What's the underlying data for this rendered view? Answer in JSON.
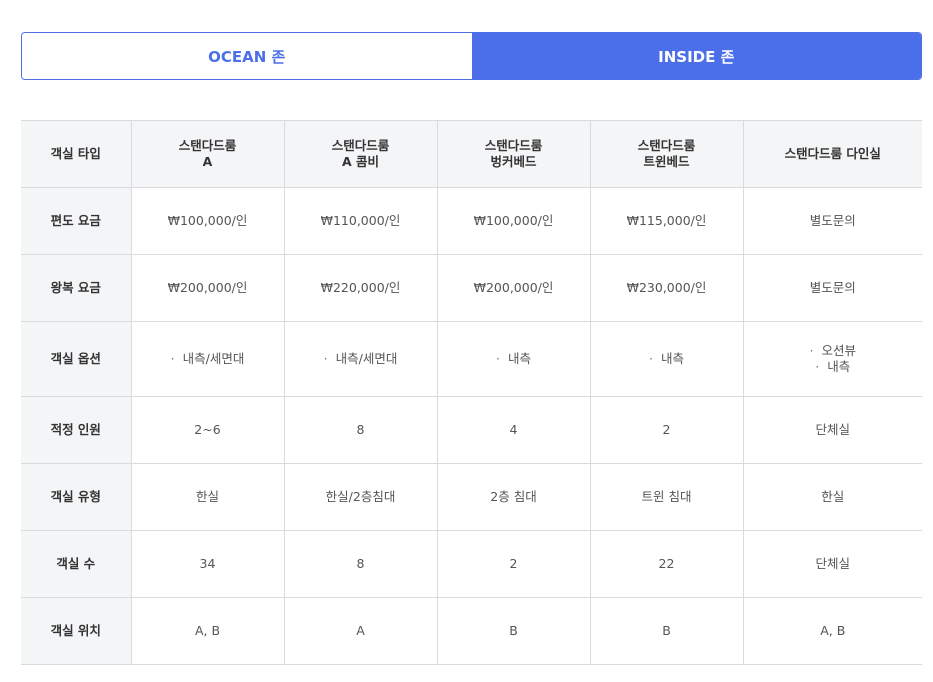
{
  "tabs": [
    {
      "label": "OCEAN 존",
      "active": false
    },
    {
      "label": "INSIDE 존",
      "active": true
    }
  ],
  "colors": {
    "accent": "#4a6fe8",
    "header_bg": "#f4f5f7",
    "border": "#d8dadd"
  },
  "table": {
    "corner_label": "객실 타입",
    "columns": [
      {
        "line1": "스탠다드룸",
        "line2": "A"
      },
      {
        "line1": "스탠다드룸",
        "line2": "A 콤비"
      },
      {
        "line1": "스탠다드룸",
        "line2": "벙커베드"
      },
      {
        "line1": "스탠다드룸",
        "line2": "트윈베드"
      },
      {
        "line1": "스탠다드룸 다인실",
        "line2": ""
      }
    ],
    "rows": {
      "oneway": {
        "label": "편도 요금",
        "cells": [
          "₩100,000/인",
          "₩110,000/인",
          "₩100,000/인",
          "₩115,000/인",
          "별도문의"
        ]
      },
      "roundtrip": {
        "label": "왕복 요금",
        "cells": [
          "₩200,000/인",
          "₩220,000/인",
          "₩200,000/인",
          "₩230,000/인",
          "별도문의"
        ]
      },
      "options": {
        "label": "객실 옵션",
        "cells": [
          [
            "내측/세면대"
          ],
          [
            "내측/세면대"
          ],
          [
            "내측"
          ],
          [
            "내측"
          ],
          [
            "오션뷰",
            "내측"
          ]
        ]
      },
      "capacity": {
        "label": "적정 인원",
        "cells": [
          "2~6",
          "8",
          "4",
          "2",
          "단체실"
        ]
      },
      "roomtype": {
        "label": "객실 유형",
        "cells": [
          "한실",
          "한실/2층침대",
          "2층 침대",
          "트윈 침대",
          "한실"
        ]
      },
      "count": {
        "label": "객실 수",
        "cells": [
          "34",
          "8",
          "2",
          "22",
          "단체실"
        ]
      },
      "location": {
        "label": "객실 위치",
        "cells": [
          "A, B",
          "A",
          "B",
          "B",
          "A, B"
        ]
      }
    }
  }
}
